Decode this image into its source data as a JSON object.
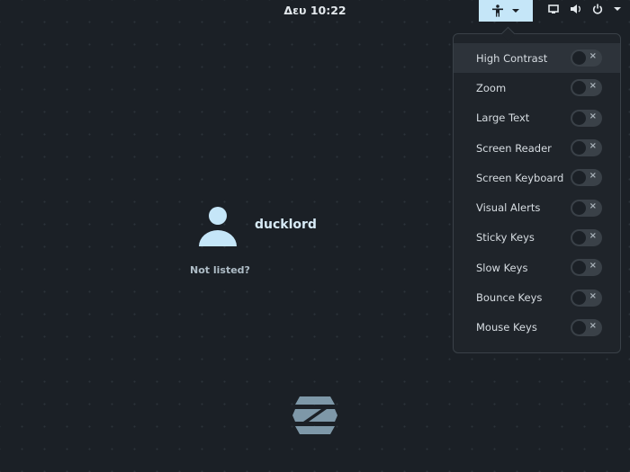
{
  "topbar": {
    "clock": "Δευ 10:22"
  },
  "accessibility_menu": {
    "items": [
      {
        "label": "High Contrast",
        "on": false
      },
      {
        "label": "Zoom",
        "on": false
      },
      {
        "label": "Large Text",
        "on": false
      },
      {
        "label": "Screen Reader",
        "on": false
      },
      {
        "label": "Screen Keyboard",
        "on": false
      },
      {
        "label": "Visual Alerts",
        "on": false
      },
      {
        "label": "Sticky Keys",
        "on": false
      },
      {
        "label": "Slow Keys",
        "on": false
      },
      {
        "label": "Bounce Keys",
        "on": false
      },
      {
        "label": "Mouse Keys",
        "on": false
      }
    ],
    "toggle_off_glyph": "×"
  },
  "login": {
    "username": "ducklord",
    "not_listed": "Not listed?"
  }
}
